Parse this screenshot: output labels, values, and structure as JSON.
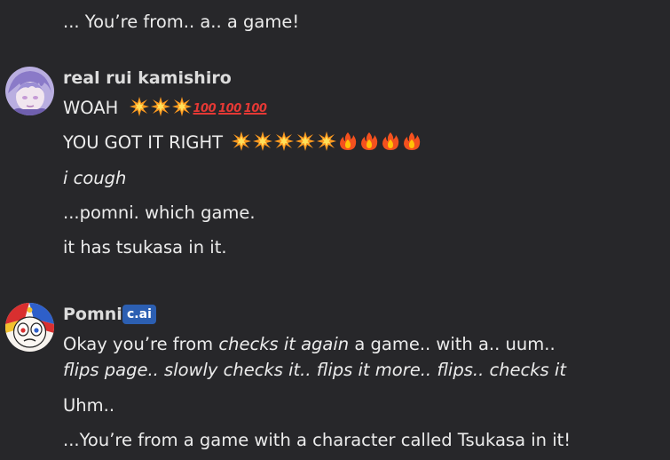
{
  "messages": [
    {
      "continuation": "... You’re from.. a.. a game!"
    },
    {
      "author": "real rui kamishiro",
      "lines": [
        "WOAH",
        "YOU GOT IT RIGHT",
        "i cough",
        "...pomni. which game.",
        "it has tsukasa in it."
      ],
      "emoji_line1": "boom,boom,boom,100,100,100",
      "emoji_line2": "boom,boom,boom,boom,boom,fire,fire,fire,fire",
      "hundred_text": "100"
    },
    {
      "author": "Pomni",
      "badge": "c.ai",
      "line1_a": "Okay you’re from ",
      "line1_b": "checks it again",
      "line1_c": " a game.. with a.. uum..",
      "line2": "flips page.. slowly checks it.. flips it more.. flips.. checks it",
      "line3": "Uhm..",
      "line4": "...You’re from a game with a character called Tsukasa in it!"
    }
  ],
  "colors": {
    "background": "#27272a",
    "text": "#ececec",
    "badge": "#2c5fb2"
  }
}
